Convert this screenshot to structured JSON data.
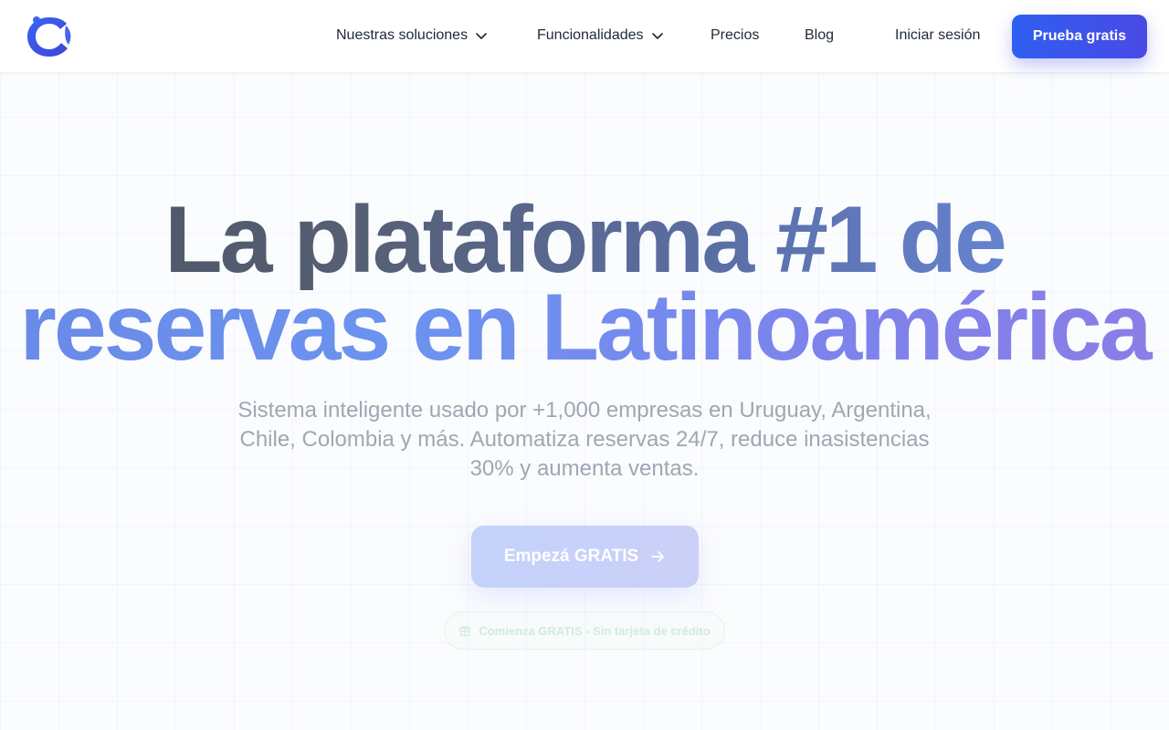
{
  "header": {
    "nav": [
      {
        "label": "Nuestras soluciones",
        "has_dropdown": true
      },
      {
        "label": "Funcionalidades",
        "has_dropdown": true
      },
      {
        "label": "Precios",
        "has_dropdown": false
      },
      {
        "label": "Blog",
        "has_dropdown": false
      }
    ],
    "login_label": "Iniciar sesión",
    "cta_label": "Prueba gratis"
  },
  "hero": {
    "title_line1": "La plataforma #1 de",
    "title_line2": "reservas en Latinoamérica",
    "subtitle": "Sistema inteligente usado por +1,000 empresas en Uruguay, Argentina, Chile, Colombia y más. Automatiza reservas 24/7, reduce inasistencias 30% y aumenta ventas.",
    "cta_label": "Empezá GRATIS",
    "badge_text": "Comienza GRATIS - Sin tarjeta de crédito"
  },
  "icons": {
    "logo": "brand-logo-icon",
    "dropdown": "chevron-down-icon",
    "cta_arrow": "arrow-right-icon",
    "badge": "gift-icon"
  },
  "colors": {
    "primary": "#2f5ff0",
    "primary_end": "#4a49e6",
    "text_dark": "#1f2937",
    "subtitle": "#a0a6b2"
  }
}
